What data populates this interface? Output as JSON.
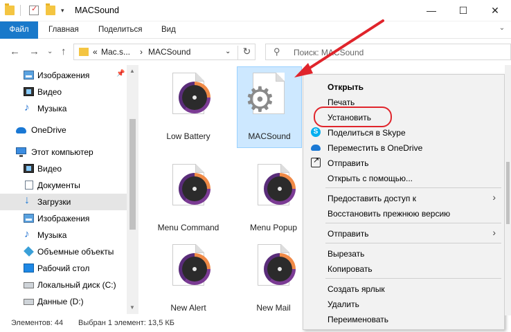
{
  "window": {
    "title": "MACSound",
    "minimize_glyph": "—",
    "maximize_glyph": "☐",
    "close_glyph": "✕"
  },
  "ribbon": {
    "tabs": [
      "Файл",
      "Главная",
      "Поделиться",
      "Вид"
    ],
    "expand_glyph": "⌄",
    "file_tab_color": "#1979ca"
  },
  "nav_buttons": {
    "back": "←",
    "forward": "→",
    "recent": "⌄",
    "up": "↑"
  },
  "address": {
    "prefix": "«",
    "segments": [
      "Mac.s...",
      "MACSound"
    ],
    "separator": "›",
    "dropdown": "⌄",
    "refresh": "↻"
  },
  "search": {
    "placeholder": "Поиск: MACSound",
    "icon": "search-icon"
  },
  "sidebar": {
    "items": [
      {
        "label": "Изображения",
        "icon": "pictures-icon",
        "pinned": true
      },
      {
        "label": "Видео",
        "icon": "video-icon"
      },
      {
        "label": "Музыка",
        "icon": "music-icon"
      },
      {
        "label": "OneDrive",
        "icon": "onedrive-icon"
      },
      {
        "label": "Этот компьютер",
        "icon": "computer-icon"
      },
      {
        "label": "Видео",
        "icon": "video-icon"
      },
      {
        "label": "Документы",
        "icon": "documents-icon"
      },
      {
        "label": "Загрузки",
        "icon": "downloads-icon",
        "selected": true
      },
      {
        "label": "Изображения",
        "icon": "pictures-icon"
      },
      {
        "label": "Музыка",
        "icon": "music-icon"
      },
      {
        "label": "Объемные объекты",
        "icon": "3d-objects-icon"
      },
      {
        "label": "Рабочий стол",
        "icon": "desktop-icon"
      },
      {
        "label": "Локальный диск (C:)",
        "icon": "disk-icon"
      },
      {
        "label": "Данные (D:)",
        "icon": "disk-icon"
      }
    ]
  },
  "files": [
    {
      "name": "Low Battery",
      "icon": "audio-file-icon"
    },
    {
      "name": "MACSound",
      "icon": "settings-file-icon",
      "selected": true
    },
    {
      "name": "Menu Command",
      "icon": "audio-file-icon"
    },
    {
      "name": "Menu Popup",
      "icon": "audio-file-icon"
    },
    {
      "name": "New Alert",
      "icon": "audio-file-icon"
    },
    {
      "name": "New Mail",
      "icon": "audio-file-icon"
    }
  ],
  "status": {
    "count": "Элементов: 44",
    "selection": "Выбран 1 элемент: 13,5 КБ"
  },
  "context_menu": {
    "items": [
      {
        "label": "Открыть",
        "bold": true
      },
      {
        "label": "Печать"
      },
      {
        "label": "Установить",
        "highlighted": true
      },
      {
        "label": "Поделиться в Skype",
        "icon": "skype-icon"
      },
      {
        "label": "Переместить в OneDrive",
        "icon": "onedrive-icon"
      },
      {
        "label": "Отправить",
        "icon": "share-icon"
      },
      {
        "label": "Открыть с помощью..."
      },
      {
        "label": "Предоставить доступ к",
        "submenu": true
      },
      {
        "label": "Восстановить прежнюю версию"
      },
      {
        "label": "Отправить",
        "submenu": true
      },
      {
        "label": "Вырезать"
      },
      {
        "label": "Копировать"
      },
      {
        "label": "Создать ярлык"
      },
      {
        "label": "Удалить"
      },
      {
        "label": "Переименовать"
      }
    ],
    "submenu_glyph": "›"
  },
  "colors": {
    "annotation_red": "#e0242b",
    "selection_bg": "#cde8ff",
    "menu_bg": "#f2f2f2"
  }
}
